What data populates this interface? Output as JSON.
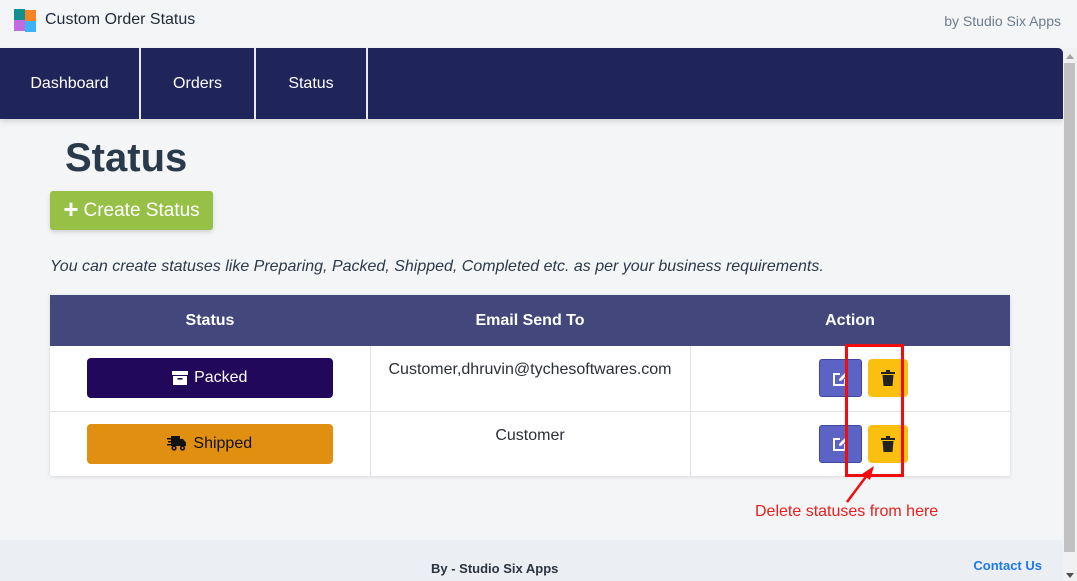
{
  "header": {
    "app_title": "Custom Order Status",
    "byline": "by Studio Six Apps",
    "logo_icon": "app-logo-grid-icon"
  },
  "nav": {
    "items": [
      {
        "label": "Dashboard"
      },
      {
        "label": "Orders"
      },
      {
        "label": "Status"
      }
    ]
  },
  "main": {
    "page_title": "Status",
    "create_button": {
      "label": "Create Status",
      "icon": "plus-icon"
    },
    "hint": "You can create statuses like Preparing, Packed, Shipped, Completed etc. as per your business requirements."
  },
  "table": {
    "columns": [
      "Status",
      "Email Send To",
      "Action"
    ],
    "rows": [
      {
        "status": "Packed",
        "status_icon": "archive-box-icon",
        "status_color": "#22085a",
        "email_send_to": "Customer,dhruvin@tychesoftwares.com",
        "actions": [
          "edit-icon",
          "trash-icon"
        ]
      },
      {
        "status": "Shipped",
        "status_icon": "shipping-fast-icon",
        "status_color": "#e08f11",
        "email_send_to": "Customer",
        "actions": [
          "edit-icon",
          "trash-icon"
        ]
      }
    ]
  },
  "annotation": {
    "text": "Delete statuses from here",
    "color": "#ea1d1d"
  },
  "footer": {
    "text": "By - Studio Six Apps",
    "contact_label": "Contact Us"
  },
  "colors": {
    "nav_bg": "#1f255b",
    "table_header_bg": "#43477b",
    "create_button": "#97c047",
    "edit_button": "#5b64c4",
    "delete_button": "#fbc00f",
    "link": "#1f7ae8"
  }
}
